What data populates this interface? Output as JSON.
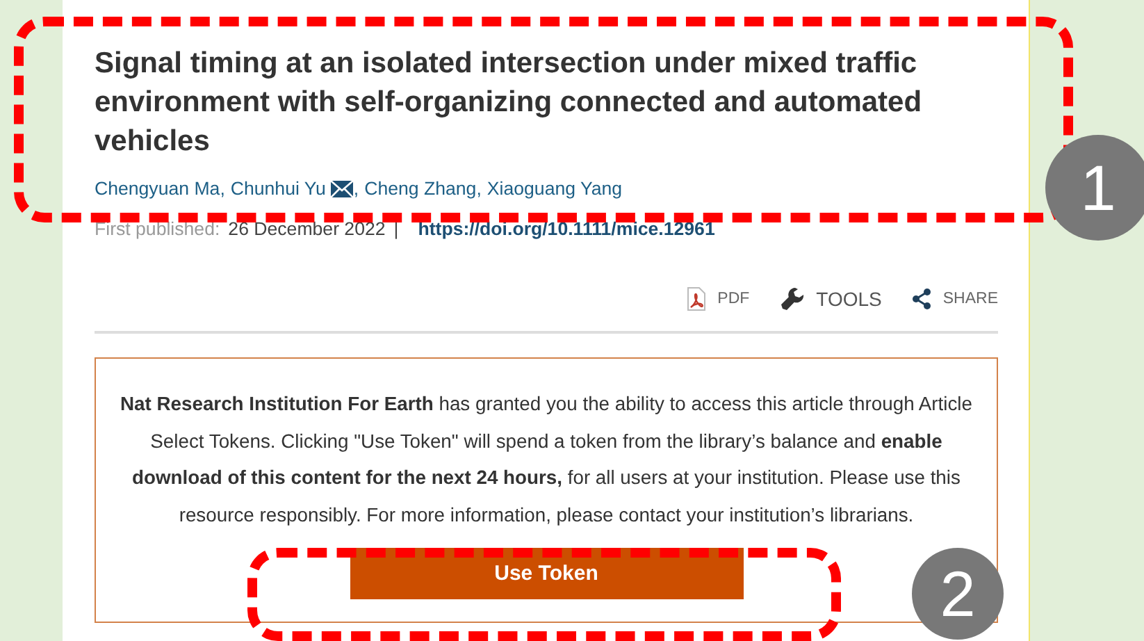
{
  "article": {
    "title": "Signal timing at an isolated intersection under mixed traffic environment with self-organizing connected and automated vehicles",
    "authors": [
      {
        "name": "Chengyuan Ma",
        "corresponding": false
      },
      {
        "name": "Chunhui Yu",
        "corresponding": true
      },
      {
        "name": "Cheng Zhang",
        "corresponding": false
      },
      {
        "name": "Xiaoguang Yang",
        "corresponding": false
      }
    ],
    "author_separator": ",",
    "published_label": "First published:",
    "published_date": "26 December 2022",
    "separator": "|",
    "doi": "https://doi.org/10.1111/mice.12961"
  },
  "toolbar": [
    {
      "kind": "pdf",
      "label": "PDF"
    },
    {
      "kind": "tools",
      "label": "TOOLS"
    },
    {
      "kind": "share",
      "label": "SHARE"
    }
  ],
  "access_notice": {
    "text": "**Nat Research Institution For Earth** has granted you the ability to access this article through Article Select Tokens. Clicking \"Use Token\" will spend a token from the library’s balance and **enable download of this content for the next 24 hours,** for all users at your institution. Please use this resource responsibly. For more information, please contact your institution’s librarians.",
    "button": "Use Token"
  },
  "annotations": [
    {
      "number": "1"
    },
    {
      "number": "2"
    }
  ]
}
